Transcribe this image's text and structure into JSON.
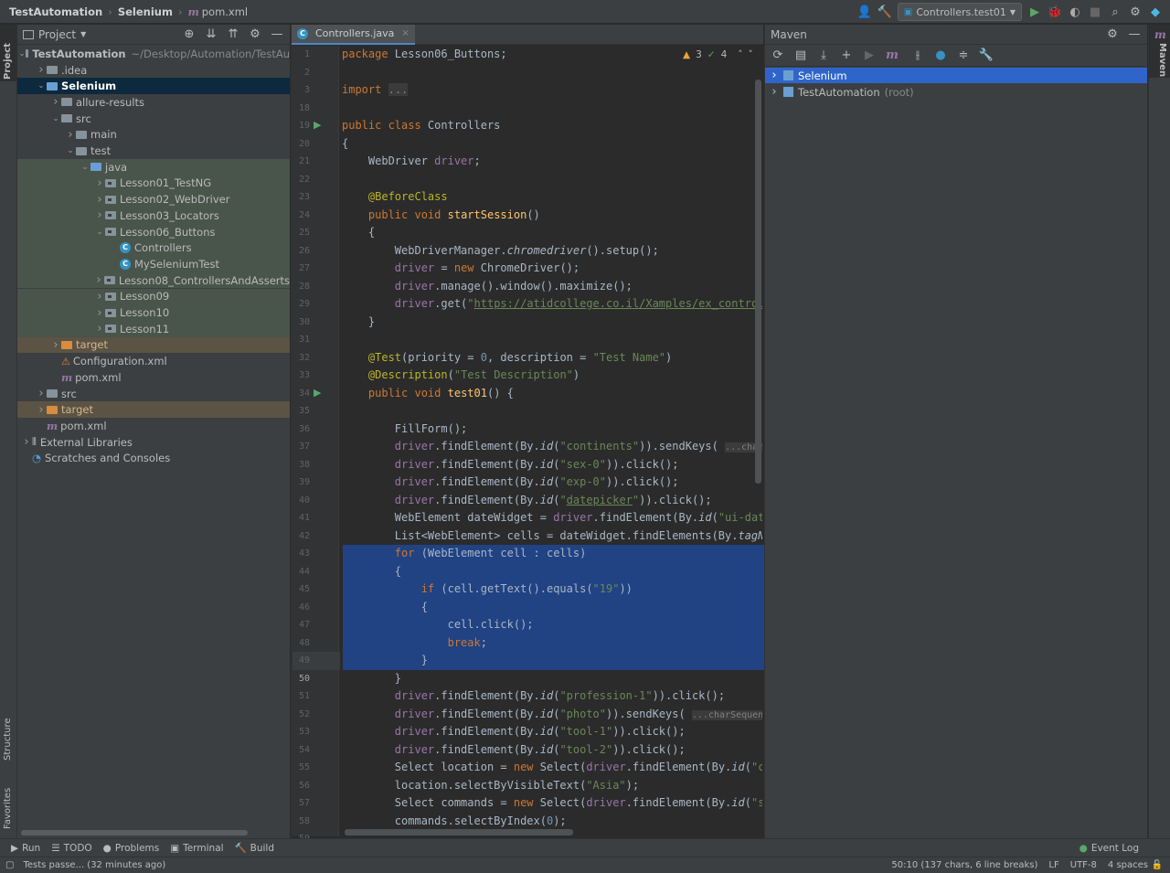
{
  "breadcrumbs": [
    "TestAutomation",
    "Selenium",
    "pom.xml"
  ],
  "run_config": "Controllers.test01",
  "left_strip": {
    "project": "Project",
    "structure": "Structure",
    "favorites": "Favorites"
  },
  "right_strip": {
    "maven": "Maven"
  },
  "project_panel": {
    "title": "Project",
    "tree": [
      {
        "label": "TestAutomation",
        "suffix": "~/Desktop/Automation/TestAu",
        "indent": 0,
        "arrow": "v",
        "icon": "folder",
        "bold": true
      },
      {
        "label": ".idea",
        "indent": 1,
        "arrow": ">",
        "icon": "folder"
      },
      {
        "label": "Selenium",
        "indent": 1,
        "arrow": "v",
        "icon": "folder-blue",
        "bold": true,
        "selected": true
      },
      {
        "label": "allure-results",
        "indent": 2,
        "arrow": ">",
        "icon": "folder"
      },
      {
        "label": "src",
        "indent": 2,
        "arrow": "v",
        "icon": "folder"
      },
      {
        "label": "main",
        "indent": 3,
        "arrow": ">",
        "icon": "folder"
      },
      {
        "label": "test",
        "indent": 3,
        "arrow": "v",
        "icon": "folder"
      },
      {
        "label": "java",
        "indent": 4,
        "arrow": "v",
        "icon": "folder-green",
        "green": true
      },
      {
        "label": "Lesson01_TestNG",
        "indent": 5,
        "arrow": ">",
        "icon": "package",
        "green": true
      },
      {
        "label": "Lesson02_WebDriver",
        "indent": 5,
        "arrow": ">",
        "icon": "package",
        "green": true
      },
      {
        "label": "Lesson03_Locators",
        "indent": 5,
        "arrow": ">",
        "icon": "package",
        "green": true
      },
      {
        "label": "Lesson06_Buttons",
        "indent": 5,
        "arrow": "v",
        "icon": "package",
        "green": true
      },
      {
        "label": "Controllers",
        "indent": 6,
        "arrow": "",
        "icon": "class",
        "green": true
      },
      {
        "label": "MySeleniumTest",
        "indent": 6,
        "arrow": "",
        "icon": "class",
        "green": true
      },
      {
        "label": "Lesson08_ControllersAndAsserts",
        "indent": 5,
        "arrow": ">",
        "icon": "package",
        "green": true
      },
      {
        "label": "Lesson09",
        "indent": 5,
        "arrow": ">",
        "icon": "package",
        "green": true
      },
      {
        "label": "Lesson10",
        "indent": 5,
        "arrow": ">",
        "icon": "package",
        "green": true
      },
      {
        "label": "Lesson11",
        "indent": 5,
        "arrow": ">",
        "icon": "package",
        "green": true
      },
      {
        "label": "target",
        "indent": 2,
        "arrow": ">",
        "icon": "folder-orange",
        "brown": true
      },
      {
        "label": "Configuration.xml",
        "indent": 2,
        "arrow": "",
        "icon": "xml"
      },
      {
        "label": "pom.xml",
        "indent": 2,
        "arrow": "",
        "icon": "maven"
      },
      {
        "label": "src",
        "indent": 1,
        "arrow": ">",
        "icon": "folder"
      },
      {
        "label": "target",
        "indent": 1,
        "arrow": ">",
        "icon": "folder-orange",
        "brown": true
      },
      {
        "label": "pom.xml",
        "indent": 1,
        "arrow": "",
        "icon": "maven"
      },
      {
        "label": "External Libraries",
        "indent": 0,
        "arrow": ">",
        "icon": "libs"
      },
      {
        "label": "Scratches and Consoles",
        "indent": 0,
        "arrow": "",
        "icon": "scratch"
      }
    ]
  },
  "editor": {
    "tab": "Controllers.java",
    "inspections": {
      "warnings": "3",
      "ok": "4"
    },
    "lines": [
      {
        "n": "1",
        "html": "<span class='kw'>package</span> Lesson06_Buttons;"
      },
      {
        "n": "2",
        "html": ""
      },
      {
        "n": "3",
        "html": "<span class='kw'>import</span> <span class='cm' style='background:#3b3b3b'>...</span>"
      },
      {
        "n": "18",
        "html": ""
      },
      {
        "n": "19",
        "html": "<span class='kw'>public class</span> Controllers"
      },
      {
        "n": "20",
        "html": "{"
      },
      {
        "n": "21",
        "html": "    WebDriver <span class='fld'>driver</span>;"
      },
      {
        "n": "22",
        "html": ""
      },
      {
        "n": "23",
        "html": "    <span class='ann'>@BeforeClass</span>"
      },
      {
        "n": "24",
        "html": "    <span class='kw'>public void</span> <span class='fn'>startSession</span>()"
      },
      {
        "n": "25",
        "html": "    {"
      },
      {
        "n": "26",
        "html": "        WebDriverManager.<span class='it'>chromedriver</span>().setup();"
      },
      {
        "n": "27",
        "html": "        <span class='fld'>driver</span> = <span class='kw'>new</span> ChromeDriver();"
      },
      {
        "n": "28",
        "html": "        <span class='fld'>driver</span>.manage().window().maximize();"
      },
      {
        "n": "29",
        "html": "        <span class='fld'>driver</span>.get(<span class='str'>\"<u>https://atidcollege.co.il/Xamples/ex_controll</u></span>"
      },
      {
        "n": "30",
        "html": "    }"
      },
      {
        "n": "31",
        "html": ""
      },
      {
        "n": "32",
        "html": "    <span class='ann'>@Test</span>(priority = <span class='num'>0</span>, description = <span class='str'>\"Test Name\"</span>)"
      },
      {
        "n": "33",
        "html": "    <span class='ann'>@Description</span>(<span class='str'>\"Test Description\"</span>)"
      },
      {
        "n": "34",
        "html": "    <span class='kw'>public void</span> <span class='fn'>test01</span>() {"
      },
      {
        "n": "35",
        "html": ""
      },
      {
        "n": "36",
        "html": "        FillForm();"
      },
      {
        "n": "37",
        "html": "        <span class='fld'>driver</span>.findElement(By.<span class='it'>id</span>(<span class='str'>\"continents\"</span>)).sendKeys( <span class='cm' style='background:#3b3b3b;font-size:10px'>...charSeq</span>"
      },
      {
        "n": "38",
        "html": "        <span class='fld'>driver</span>.findElement(By.<span class='it'>id</span>(<span class='str'>\"sex-0\"</span>)).click();"
      },
      {
        "n": "39",
        "html": "        <span class='fld'>driver</span>.findElement(By.<span class='it'>id</span>(<span class='str'>\"exp-0\"</span>)).click();"
      },
      {
        "n": "40",
        "html": "        <span class='fld'>driver</span>.findElement(By.<span class='it'>id</span>(<span class='str'>\"<u>datepicker</u>\"</span>)).click();"
      },
      {
        "n": "41",
        "html": "        WebElement dateWidget = <span class='fld'>driver</span>.findElement(By.<span class='it'>id</span>(<span class='str'>\"ui-date</span>"
      },
      {
        "n": "42",
        "html": "        List&lt;WebElement&gt; cells = dateWidget.findElements(By.<span class='it'>tagNa</span>"
      },
      {
        "n": "43",
        "html": "        <span class='kw'>for</span> (WebElement cell : cells)"
      },
      {
        "n": "44",
        "html": "        {"
      },
      {
        "n": "45",
        "html": "            <span class='kw'>if</span> (cell.getText().equals(<span class='str'>\"19\"</span>))"
      },
      {
        "n": "46",
        "html": "            {"
      },
      {
        "n": "47",
        "html": "                cell.click();"
      },
      {
        "n": "48",
        "html": "                <span class='kw'>break</span>;"
      },
      {
        "n": "49",
        "html": "            }"
      },
      {
        "n": "50",
        "html": "        }"
      },
      {
        "n": "51",
        "html": "        <span class='fld'>driver</span>.findElement(By.<span class='it'>id</span>(<span class='str'>\"profession-1\"</span>)).click();"
      },
      {
        "n": "52",
        "html": "        <span class='fld'>driver</span>.findElement(By.<span class='it'>id</span>(<span class='str'>\"photo\"</span>)).sendKeys( <span class='cm' style='background:#3b3b3b;font-size:10px'>...charSequences</span>"
      },
      {
        "n": "53",
        "html": "        <span class='fld'>driver</span>.findElement(By.<span class='it'>id</span>(<span class='str'>\"tool-1\"</span>)).click();"
      },
      {
        "n": "54",
        "html": "        <span class='fld'>driver</span>.findElement(By.<span class='it'>id</span>(<span class='str'>\"tool-2\"</span>)).click();"
      },
      {
        "n": "55",
        "html": "        Select location = <span class='kw'>new</span> Select(<span class='fld'>driver</span>.findElement(By.<span class='it'>id</span>(<span class='str'>\"co</span>"
      },
      {
        "n": "56",
        "html": "        location.selectByVisibleText(<span class='str'>\"Asia\"</span>);"
      },
      {
        "n": "57",
        "html": "        Select commands = <span class='kw'>new</span> Select(<span class='fld'>driver</span>.findElement(By.<span class='it'>id</span>(<span class='str'>\"se</span>"
      },
      {
        "n": "58",
        "html": "        commands.selectByIndex(<span class='num'>0</span>);"
      },
      {
        "n": "59",
        "html": ""
      }
    ]
  },
  "maven": {
    "title": "Maven",
    "items": [
      {
        "label": "Selenium",
        "suffix": "",
        "selected": true
      },
      {
        "label": "TestAutomation",
        "suffix": "(root)",
        "selected": false
      }
    ]
  },
  "bottom_tools": [
    "Run",
    "TODO",
    "Problems",
    "Terminal",
    "Build"
  ],
  "event_log": "Event Log",
  "status": {
    "message": "Tests passe... (32 minutes ago)",
    "position": "50:10 (137 chars, 6 line breaks)",
    "line_sep": "LF",
    "encoding": "UTF-8",
    "indent": "4 spaces"
  }
}
